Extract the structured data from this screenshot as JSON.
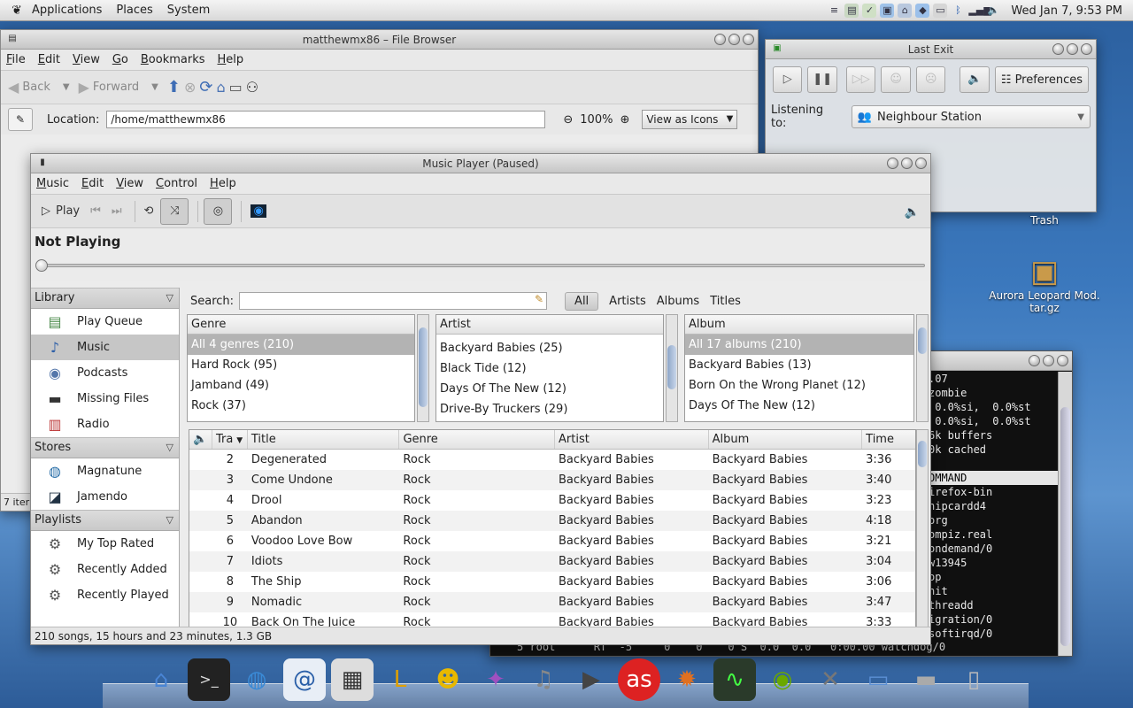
{
  "top_panel": {
    "menus": [
      "Applications",
      "Places",
      "System"
    ],
    "clock": "Wed Jan  7,  9:53 PM"
  },
  "file_browser": {
    "title": "matthewmx86 – File Browser",
    "menus": [
      "File",
      "Edit",
      "View",
      "Go",
      "Bookmarks",
      "Help"
    ],
    "back": "Back",
    "forward": "Forward",
    "location_label": "Location:",
    "location_value": "/home/matthewmx86",
    "zoom": "100%",
    "view_mode": "View as Icons",
    "status": "7 iter"
  },
  "last_exit": {
    "title": "Last Exit",
    "preferences": "Preferences",
    "listening_label": "Listening to:",
    "station": "Neighbour Station"
  },
  "desktop": {
    "trash_label": "Trash",
    "archive_label": "Aurora Leopard Mod. tar.gz"
  },
  "terminal": {
    "lines": [
      ".07",
      "zombie",
      " 0.0%si,  0.0%st",
      " 0.0%si,  0.0%st",
      "6k buffers",
      "0k cached",
      "",
      "OMMAND",
      "irefox-bin",
      "hipcardd4",
      "org",
      "ompiz.real",
      "ondemand/0",
      "w13945",
      "op",
      "nit",
      "threadd",
      "igration/0",
      "softirqd/0",
      "0:00.00 watchdog/0"
    ],
    "bottom_line": "5 root      RT  -5     0    0    0 S  0.0  0.0   0:00.00 watchdog/0"
  },
  "music_player": {
    "title": "Music Player (Paused)",
    "menus": [
      "Music",
      "Edit",
      "View",
      "Control",
      "Help"
    ],
    "play_label": "Play",
    "now_playing": "Not Playing",
    "sidebar": {
      "library_head": "Library",
      "library": [
        "Play Queue",
        "Music",
        "Podcasts",
        "Missing Files",
        "Radio"
      ],
      "stores_head": "Stores",
      "stores": [
        "Magnatune",
        "Jamendo"
      ],
      "playlists_head": "Playlists",
      "playlists": [
        "My Top Rated",
        "Recently Added",
        "Recently Played"
      ]
    },
    "search_label": "Search:",
    "filters": [
      "All",
      "Artists",
      "Albums",
      "Titles"
    ],
    "genre": {
      "header": "Genre",
      "rows": [
        "All 4 genres (210)",
        "Hard Rock (95)",
        "Jamband (49)",
        "Rock (37)"
      ]
    },
    "artist": {
      "header": "Artist",
      "rows": [
        "Backyard Babies (25)",
        "Black Tide (12)",
        "Days Of The New (12)",
        "Drive-By Truckers (29)"
      ]
    },
    "album": {
      "header": "Album",
      "rows": [
        "All 17 albums (210)",
        "Backyard Babies (13)",
        "Born On the Wrong Planet (12)",
        "Days Of The New (12)"
      ]
    },
    "columns": [
      "Tra",
      "Title",
      "Genre",
      "Artist",
      "Album",
      "Time"
    ],
    "tracks": [
      [
        "2",
        "Degenerated",
        "Rock",
        "Backyard Babies",
        "Backyard Babies",
        "3:36"
      ],
      [
        "3",
        "Come Undone",
        "Rock",
        "Backyard Babies",
        "Backyard Babies",
        "3:40"
      ],
      [
        "4",
        "Drool",
        "Rock",
        "Backyard Babies",
        "Backyard Babies",
        "3:23"
      ],
      [
        "5",
        "Abandon",
        "Rock",
        "Backyard Babies",
        "Backyard Babies",
        "4:18"
      ],
      [
        "6",
        "Voodoo Love Bow",
        "Rock",
        "Backyard Babies",
        "Backyard Babies",
        "3:21"
      ],
      [
        "7",
        "Idiots",
        "Rock",
        "Backyard Babies",
        "Backyard Babies",
        "3:04"
      ],
      [
        "8",
        "The Ship",
        "Rock",
        "Backyard Babies",
        "Backyard Babies",
        "3:06"
      ],
      [
        "9",
        "Nomadic",
        "Rock",
        "Backyard Babies",
        "Backyard Babies",
        "3:47"
      ],
      [
        "10",
        "Back On The Juice",
        "Rock",
        "Backyard Babies",
        "Backyard Babies",
        "3:33"
      ]
    ],
    "status": "210 songs, 15 hours and 23 minutes, 1.3 GB"
  }
}
